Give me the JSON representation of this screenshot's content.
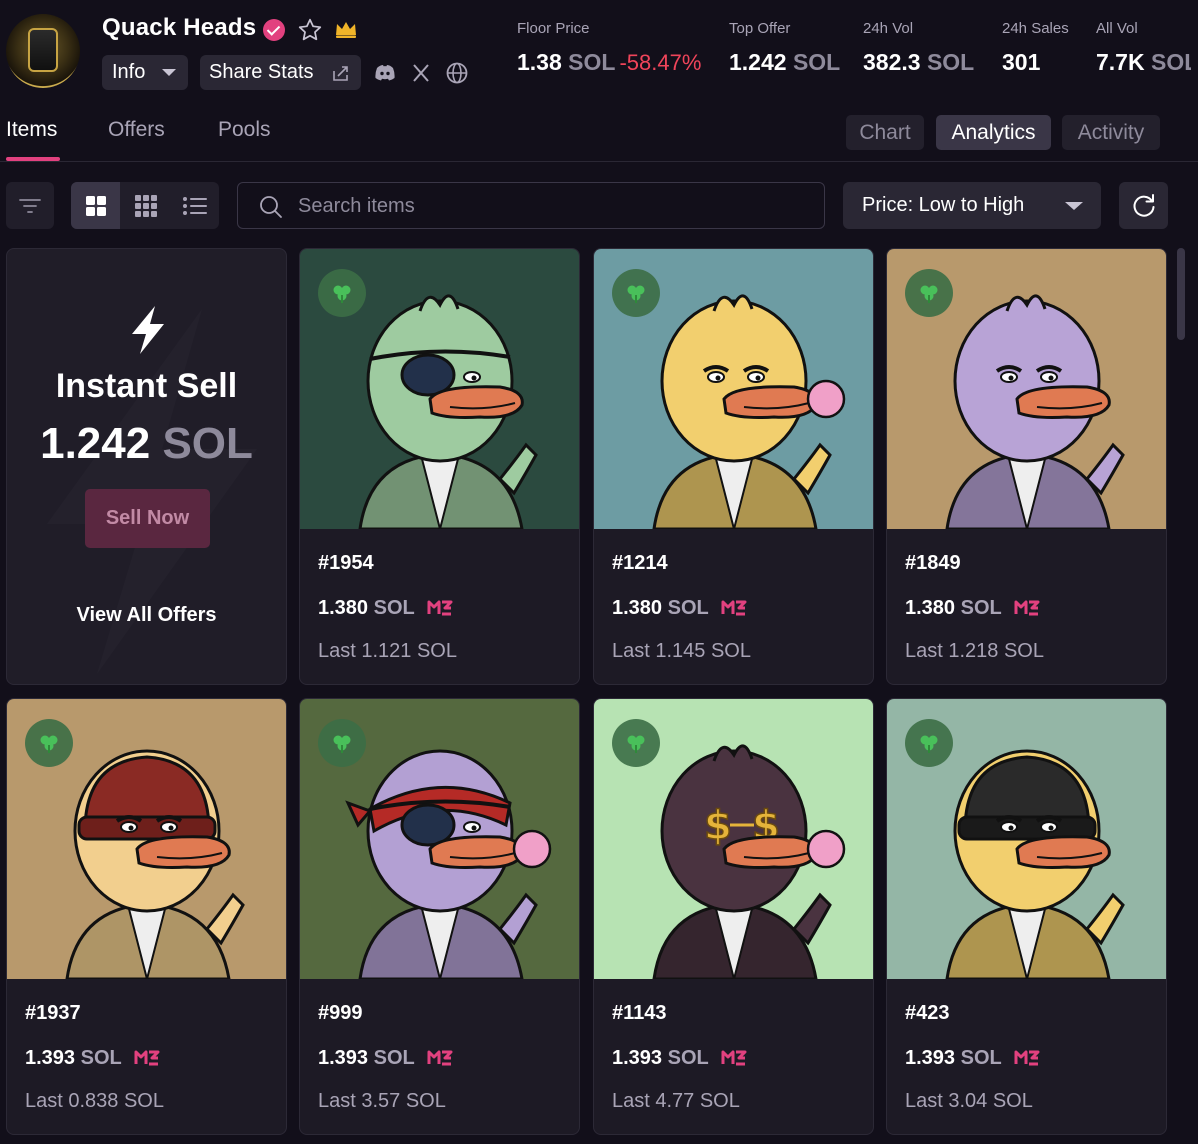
{
  "collection": {
    "name": "Quack Heads",
    "info_label": "Info",
    "share_label": "Share Stats"
  },
  "stats": [
    {
      "label": "Floor Price",
      "value": "1.38",
      "unit": "SOL",
      "change": "-58.47%"
    },
    {
      "label": "Top Offer",
      "value": "1.242",
      "unit": "SOL"
    },
    {
      "label": "24h Vol",
      "value": "382.3",
      "unit": "SOL"
    },
    {
      "label": "24h Sales",
      "value": "301"
    },
    {
      "label": "All Vol",
      "value": "7.7K",
      "unit": "SOL"
    }
  ],
  "tabs": [
    "Items",
    "Offers",
    "Pools"
  ],
  "right_tabs": [
    "Chart",
    "Analytics",
    "Activity"
  ],
  "search": {
    "placeholder": "Search items"
  },
  "sort": {
    "selected": "Price: Low to High"
  },
  "instant_sell": {
    "title": "Instant Sell",
    "value": "1.242",
    "unit": "SOL",
    "button": "Sell Now",
    "link": "View All Offers"
  },
  "colors": {
    "background": "#120f1a",
    "accent": "#e2417f",
    "negative": "#f0445a"
  },
  "items": [
    {
      "name": "#1954",
      "price": "1.380",
      "unit": "SOL",
      "last": "Last 1.121 SOL",
      "bg": "#2b4a3f",
      "body": "#9ecba0",
      "hat": "none",
      "eyewear": "patch"
    },
    {
      "name": "#1214",
      "price": "1.380",
      "unit": "SOL",
      "last": "Last 1.145 SOL",
      "bg": "#6d9ca3",
      "body": "#f2cf6e",
      "hat": "none",
      "eyewear": "none"
    },
    {
      "name": "#1849",
      "price": "1.380",
      "unit": "SOL",
      "last": "Last 1.218 SOL",
      "bg": "#b8996c",
      "body": "#b8a3d6",
      "hat": "none",
      "eyewear": "none"
    },
    {
      "name": "#1937",
      "price": "1.393",
      "unit": "SOL",
      "last": "Last 0.838 SOL",
      "bg": "#b8996c",
      "body": "#f2cf8e",
      "hat": "beanie-red",
      "eyewear": "none"
    },
    {
      "name": "#999",
      "price": "1.393",
      "unit": "SOL",
      "last": "Last 3.57 SOL",
      "bg": "#55693f",
      "body": "#b3a0d3",
      "hat": "bandana",
      "eyewear": "patch"
    },
    {
      "name": "#1143",
      "price": "1.393",
      "unit": "SOL",
      "last": "Last 4.77 SOL",
      "bg": "#b7e3b3",
      "body": "#4a3340",
      "hat": "none",
      "eyewear": "dollar-glasses"
    },
    {
      "name": "#423",
      "price": "1.393",
      "unit": "SOL",
      "last": "Last 3.04 SOL",
      "bg": "#94b6a6",
      "body": "#f2cf6e",
      "hat": "beanie-black",
      "eyewear": "none"
    }
  ]
}
